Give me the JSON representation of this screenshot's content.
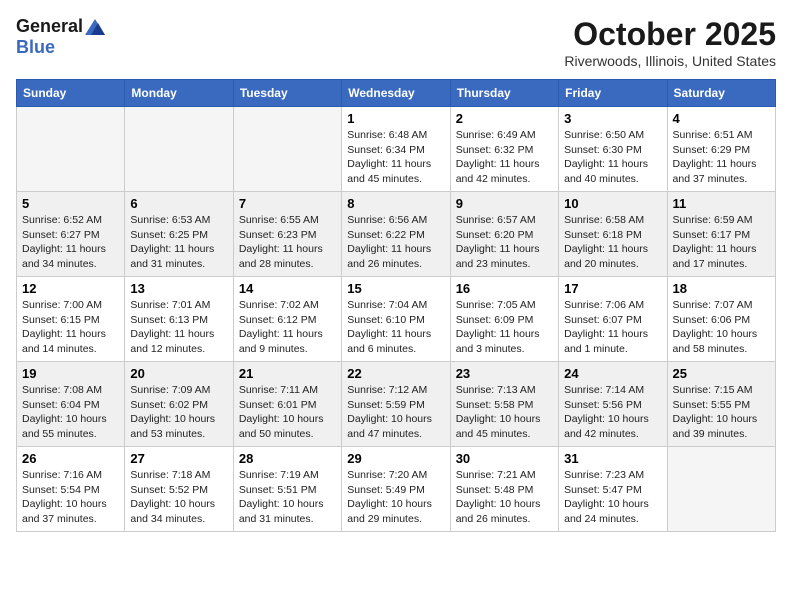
{
  "header": {
    "logo_general": "General",
    "logo_blue": "Blue",
    "month_title": "October 2025",
    "location": "Riverwoods, Illinois, United States"
  },
  "days_of_week": [
    "Sunday",
    "Monday",
    "Tuesday",
    "Wednesday",
    "Thursday",
    "Friday",
    "Saturday"
  ],
  "weeks": [
    [
      {
        "day": "",
        "empty": true
      },
      {
        "day": "",
        "empty": true
      },
      {
        "day": "",
        "empty": true
      },
      {
        "day": "1",
        "sunrise": "6:48 AM",
        "sunset": "6:34 PM",
        "daylight": "11 hours and 45 minutes."
      },
      {
        "day": "2",
        "sunrise": "6:49 AM",
        "sunset": "6:32 PM",
        "daylight": "11 hours and 42 minutes."
      },
      {
        "day": "3",
        "sunrise": "6:50 AM",
        "sunset": "6:30 PM",
        "daylight": "11 hours and 40 minutes."
      },
      {
        "day": "4",
        "sunrise": "6:51 AM",
        "sunset": "6:29 PM",
        "daylight": "11 hours and 37 minutes."
      }
    ],
    [
      {
        "day": "5",
        "sunrise": "6:52 AM",
        "sunset": "6:27 PM",
        "daylight": "11 hours and 34 minutes."
      },
      {
        "day": "6",
        "sunrise": "6:53 AM",
        "sunset": "6:25 PM",
        "daylight": "11 hours and 31 minutes."
      },
      {
        "day": "7",
        "sunrise": "6:55 AM",
        "sunset": "6:23 PM",
        "daylight": "11 hours and 28 minutes."
      },
      {
        "day": "8",
        "sunrise": "6:56 AM",
        "sunset": "6:22 PM",
        "daylight": "11 hours and 26 minutes."
      },
      {
        "day": "9",
        "sunrise": "6:57 AM",
        "sunset": "6:20 PM",
        "daylight": "11 hours and 23 minutes."
      },
      {
        "day": "10",
        "sunrise": "6:58 AM",
        "sunset": "6:18 PM",
        "daylight": "11 hours and 20 minutes."
      },
      {
        "day": "11",
        "sunrise": "6:59 AM",
        "sunset": "6:17 PM",
        "daylight": "11 hours and 17 minutes."
      }
    ],
    [
      {
        "day": "12",
        "sunrise": "7:00 AM",
        "sunset": "6:15 PM",
        "daylight": "11 hours and 14 minutes."
      },
      {
        "day": "13",
        "sunrise": "7:01 AM",
        "sunset": "6:13 PM",
        "daylight": "11 hours and 12 minutes."
      },
      {
        "day": "14",
        "sunrise": "7:02 AM",
        "sunset": "6:12 PM",
        "daylight": "11 hours and 9 minutes."
      },
      {
        "day": "15",
        "sunrise": "7:04 AM",
        "sunset": "6:10 PM",
        "daylight": "11 hours and 6 minutes."
      },
      {
        "day": "16",
        "sunrise": "7:05 AM",
        "sunset": "6:09 PM",
        "daylight": "11 hours and 3 minutes."
      },
      {
        "day": "17",
        "sunrise": "7:06 AM",
        "sunset": "6:07 PM",
        "daylight": "11 hours and 1 minute."
      },
      {
        "day": "18",
        "sunrise": "7:07 AM",
        "sunset": "6:06 PM",
        "daylight": "10 hours and 58 minutes."
      }
    ],
    [
      {
        "day": "19",
        "sunrise": "7:08 AM",
        "sunset": "6:04 PM",
        "daylight": "10 hours and 55 minutes."
      },
      {
        "day": "20",
        "sunrise": "7:09 AM",
        "sunset": "6:02 PM",
        "daylight": "10 hours and 53 minutes."
      },
      {
        "day": "21",
        "sunrise": "7:11 AM",
        "sunset": "6:01 PM",
        "daylight": "10 hours and 50 minutes."
      },
      {
        "day": "22",
        "sunrise": "7:12 AM",
        "sunset": "5:59 PM",
        "daylight": "10 hours and 47 minutes."
      },
      {
        "day": "23",
        "sunrise": "7:13 AM",
        "sunset": "5:58 PM",
        "daylight": "10 hours and 45 minutes."
      },
      {
        "day": "24",
        "sunrise": "7:14 AM",
        "sunset": "5:56 PM",
        "daylight": "10 hours and 42 minutes."
      },
      {
        "day": "25",
        "sunrise": "7:15 AM",
        "sunset": "5:55 PM",
        "daylight": "10 hours and 39 minutes."
      }
    ],
    [
      {
        "day": "26",
        "sunrise": "7:16 AM",
        "sunset": "5:54 PM",
        "daylight": "10 hours and 37 minutes."
      },
      {
        "day": "27",
        "sunrise": "7:18 AM",
        "sunset": "5:52 PM",
        "daylight": "10 hours and 34 minutes."
      },
      {
        "day": "28",
        "sunrise": "7:19 AM",
        "sunset": "5:51 PM",
        "daylight": "10 hours and 31 minutes."
      },
      {
        "day": "29",
        "sunrise": "7:20 AM",
        "sunset": "5:49 PM",
        "daylight": "10 hours and 29 minutes."
      },
      {
        "day": "30",
        "sunrise": "7:21 AM",
        "sunset": "5:48 PM",
        "daylight": "10 hours and 26 minutes."
      },
      {
        "day": "31",
        "sunrise": "7:23 AM",
        "sunset": "5:47 PM",
        "daylight": "10 hours and 24 minutes."
      },
      {
        "day": "",
        "empty": true
      }
    ]
  ]
}
